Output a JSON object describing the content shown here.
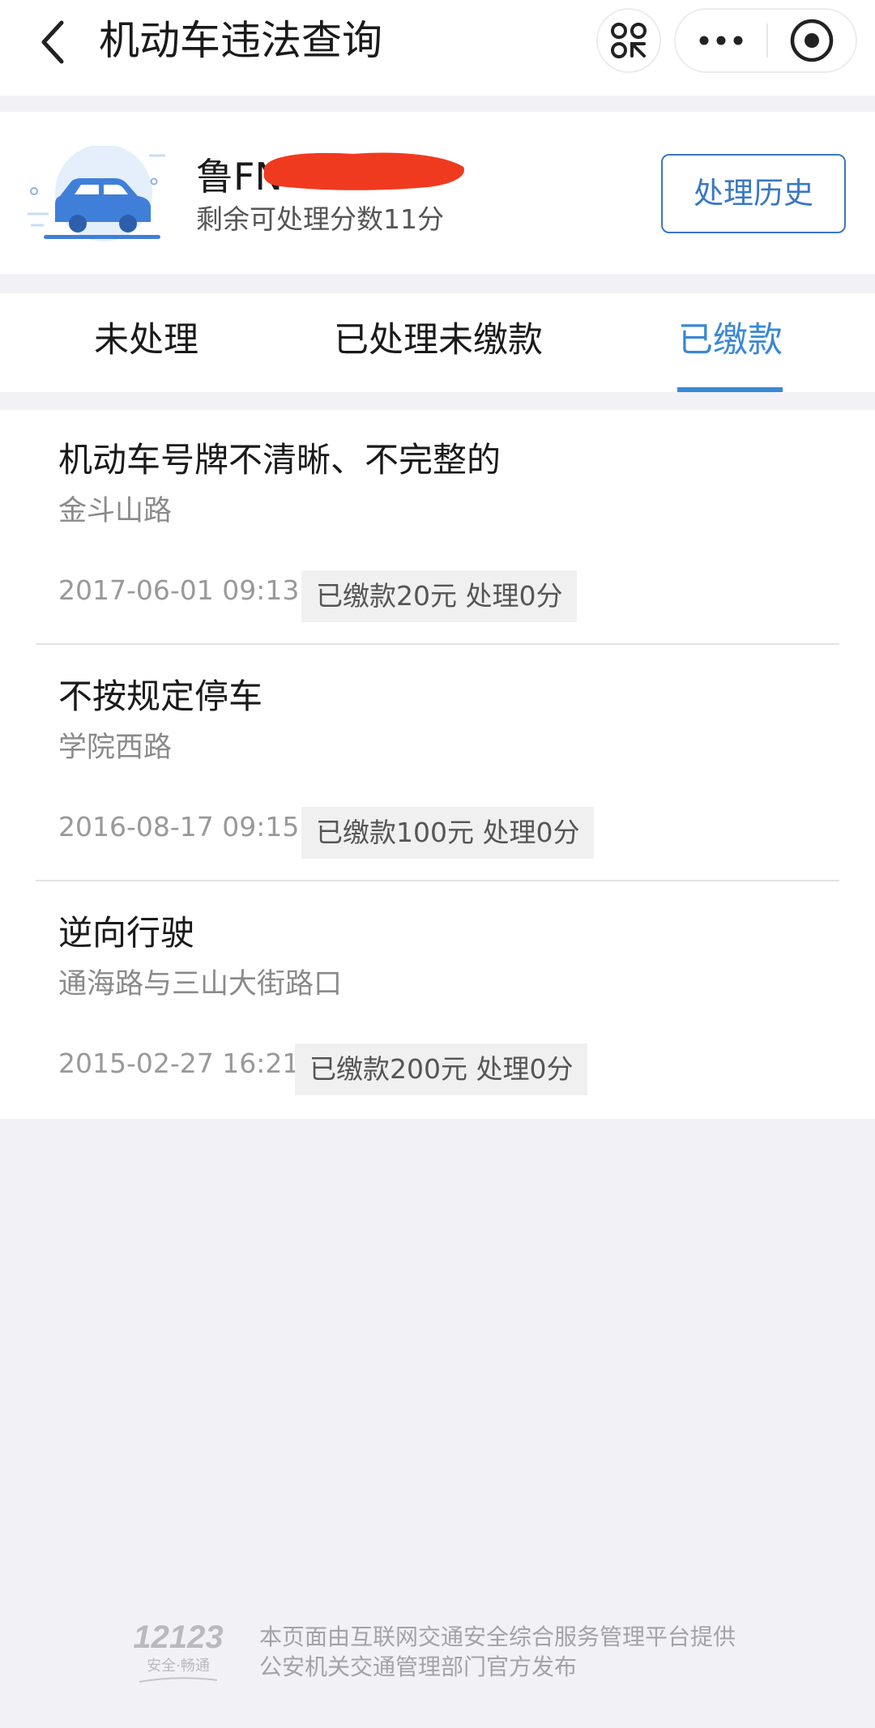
{
  "nav": {
    "title": "机动车违法查询"
  },
  "vehicle": {
    "plate": "鲁FN",
    "points_remaining": "剩余可处理分数11分",
    "history_button": "处理历史"
  },
  "tabs": [
    {
      "label": "未处理",
      "active": false
    },
    {
      "label": "已处理未缴款",
      "active": false
    },
    {
      "label": "已缴款",
      "active": true
    }
  ],
  "records": [
    {
      "violation": "机动车号牌不清晰、不完整的",
      "location": "金斗山路",
      "datetime": "2017-06-01 09:13",
      "status": "已缴款20元  处理0分"
    },
    {
      "violation": "不按规定停车",
      "location": "学院西路",
      "datetime": "2016-08-17 09:15",
      "status": "已缴款100元  处理0分"
    },
    {
      "violation": "逆向行驶",
      "location": "通海路与三山大街路口",
      "datetime": "2015-02-27 16:21",
      "status": "已缴款200元  处理0分"
    }
  ],
  "footer": {
    "logo_text": "12123",
    "logo_subtext": "安全·畅通",
    "line1": "本页面由互联网交通安全综合服务管理平台提供",
    "line2": "公安机关交通管理部门官方发布"
  },
  "colors": {
    "accent": "#3a88d4",
    "button_border": "#3a78c3",
    "redaction": "#f03a1f",
    "background": "#f2f2f6"
  }
}
